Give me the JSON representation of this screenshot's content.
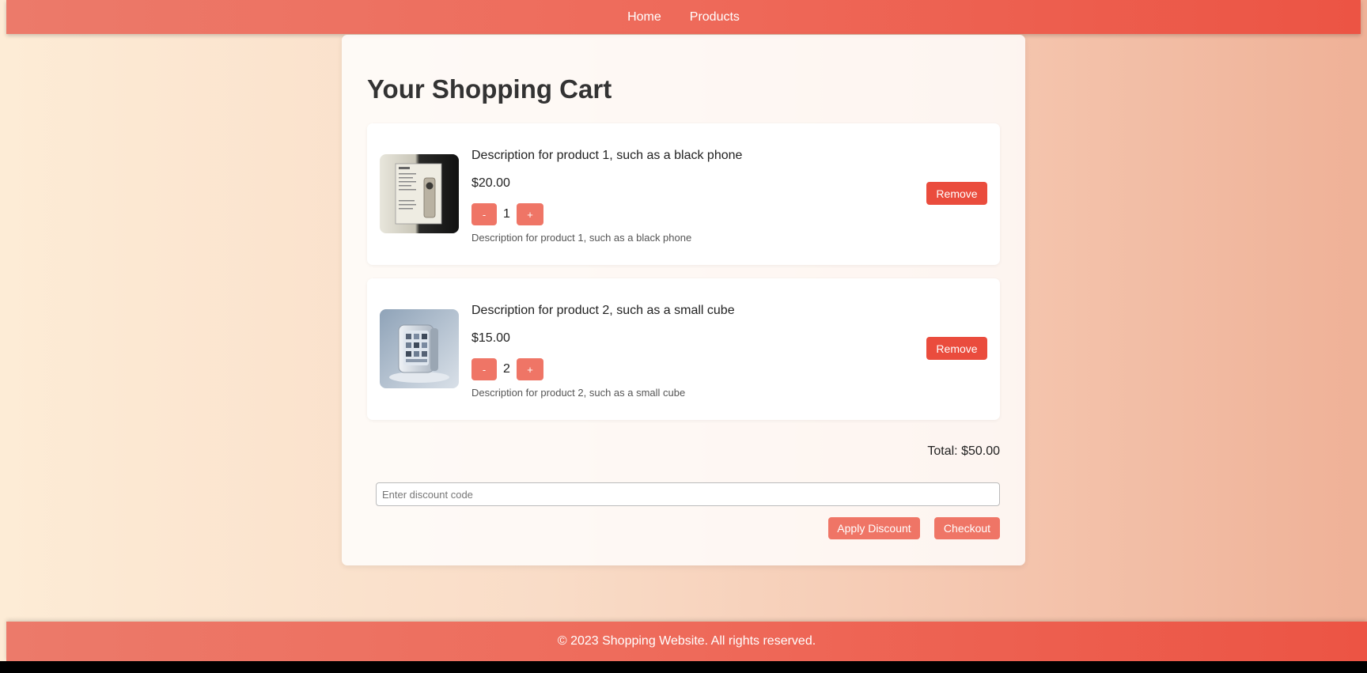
{
  "nav": {
    "home": "Home",
    "products": "Products"
  },
  "cart": {
    "title": "Your Shopping Cart",
    "items": [
      {
        "title": "Description for product 1, such as a black phone",
        "price": "$20.00",
        "quantity": "1",
        "description": "Description for product 1, such as a black phone",
        "decrement_label": "-",
        "increment_label": "+",
        "remove_label": "Remove"
      },
      {
        "title": "Description for product 2, such as a small cube",
        "price": "$15.00",
        "quantity": "2",
        "description": "Description for product 2, such as a small cube",
        "decrement_label": "-",
        "increment_label": "+",
        "remove_label": "Remove"
      }
    ],
    "total": "Total: $50.00",
    "discount_placeholder": "Enter discount code",
    "apply_label": "Apply Discount",
    "checkout_label": "Checkout"
  },
  "footer": {
    "text": "© 2023 Shopping Website. All rights reserved."
  },
  "colors": {
    "header_start": "#ec7a6a",
    "header_end": "#ec5444",
    "button": "#ef7566",
    "remove_button": "#ea4c3d",
    "background_start": "#fdecd6",
    "background_end": "#efb197"
  }
}
